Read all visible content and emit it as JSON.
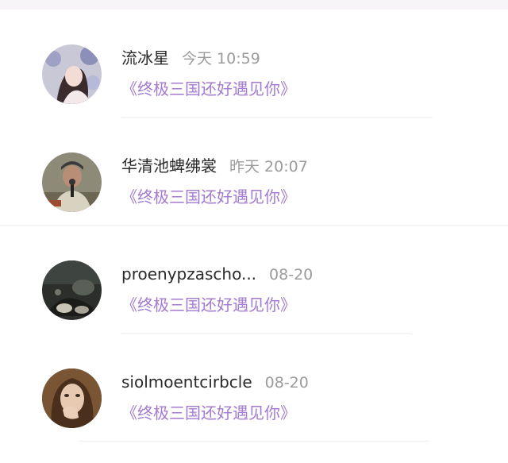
{
  "comments": [
    {
      "user": "流冰星",
      "time": "今天 10:59",
      "work": "《终极三国还好遇见你》",
      "avatar": "avatar-girl-flowers"
    },
    {
      "user": "华清池蜱绋裳",
      "time": "昨天 20:07",
      "work": "《终极三国还好遇见你》",
      "avatar": "avatar-man-microphone"
    },
    {
      "user": "proenypzascho...",
      "time": "08-20",
      "work": "《终极三国还好遇见你》",
      "avatar": "avatar-dark-scene"
    },
    {
      "user": "siolmoentcirbcle",
      "time": "08-20",
      "work": "《终极三国还好遇见你》",
      "avatar": "avatar-woman-hand"
    }
  ],
  "colors": {
    "accent_purple": "#a27bd0",
    "name_text": "#2a2a2a",
    "time_text": "#9b9b9b"
  }
}
